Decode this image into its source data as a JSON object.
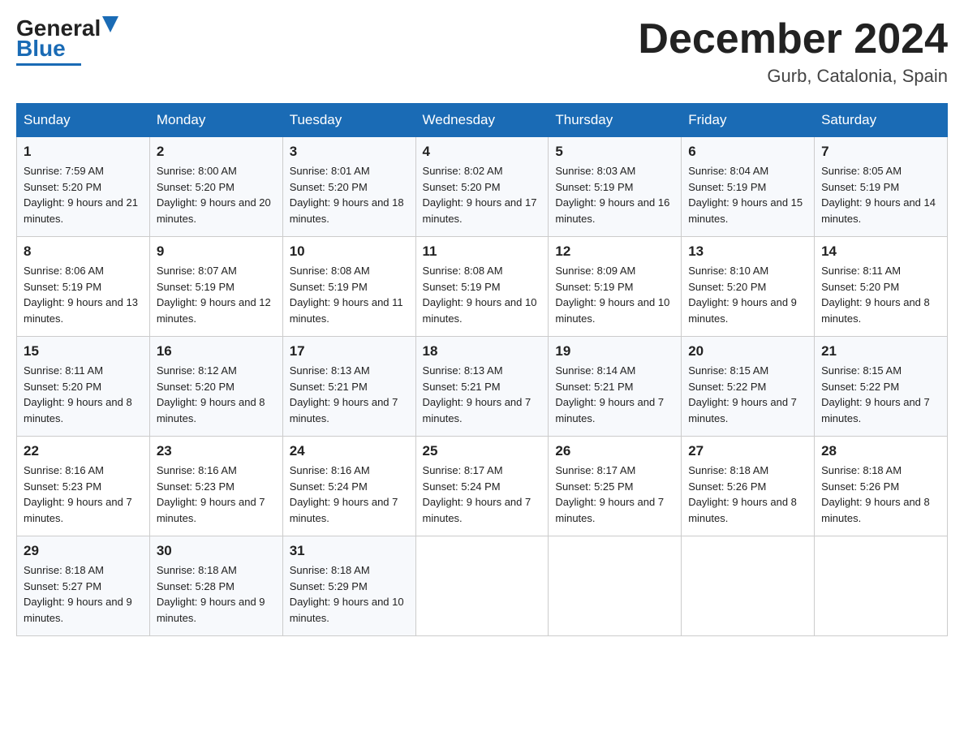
{
  "logo": {
    "text_general": "General",
    "text_blue": "Blue"
  },
  "title": "December 2024",
  "location": "Gurb, Catalonia, Spain",
  "days_of_week": [
    "Sunday",
    "Monday",
    "Tuesday",
    "Wednesday",
    "Thursday",
    "Friday",
    "Saturday"
  ],
  "weeks": [
    [
      {
        "day": "1",
        "sunrise": "7:59 AM",
        "sunset": "5:20 PM",
        "daylight": "9 hours and 21 minutes."
      },
      {
        "day": "2",
        "sunrise": "8:00 AM",
        "sunset": "5:20 PM",
        "daylight": "9 hours and 20 minutes."
      },
      {
        "day": "3",
        "sunrise": "8:01 AM",
        "sunset": "5:20 PM",
        "daylight": "9 hours and 18 minutes."
      },
      {
        "day": "4",
        "sunrise": "8:02 AM",
        "sunset": "5:20 PM",
        "daylight": "9 hours and 17 minutes."
      },
      {
        "day": "5",
        "sunrise": "8:03 AM",
        "sunset": "5:19 PM",
        "daylight": "9 hours and 16 minutes."
      },
      {
        "day": "6",
        "sunrise": "8:04 AM",
        "sunset": "5:19 PM",
        "daylight": "9 hours and 15 minutes."
      },
      {
        "day": "7",
        "sunrise": "8:05 AM",
        "sunset": "5:19 PM",
        "daylight": "9 hours and 14 minutes."
      }
    ],
    [
      {
        "day": "8",
        "sunrise": "8:06 AM",
        "sunset": "5:19 PM",
        "daylight": "9 hours and 13 minutes."
      },
      {
        "day": "9",
        "sunrise": "8:07 AM",
        "sunset": "5:19 PM",
        "daylight": "9 hours and 12 minutes."
      },
      {
        "day": "10",
        "sunrise": "8:08 AM",
        "sunset": "5:19 PM",
        "daylight": "9 hours and 11 minutes."
      },
      {
        "day": "11",
        "sunrise": "8:08 AM",
        "sunset": "5:19 PM",
        "daylight": "9 hours and 10 minutes."
      },
      {
        "day": "12",
        "sunrise": "8:09 AM",
        "sunset": "5:19 PM",
        "daylight": "9 hours and 10 minutes."
      },
      {
        "day": "13",
        "sunrise": "8:10 AM",
        "sunset": "5:20 PM",
        "daylight": "9 hours and 9 minutes."
      },
      {
        "day": "14",
        "sunrise": "8:11 AM",
        "sunset": "5:20 PM",
        "daylight": "9 hours and 8 minutes."
      }
    ],
    [
      {
        "day": "15",
        "sunrise": "8:11 AM",
        "sunset": "5:20 PM",
        "daylight": "9 hours and 8 minutes."
      },
      {
        "day": "16",
        "sunrise": "8:12 AM",
        "sunset": "5:20 PM",
        "daylight": "9 hours and 8 minutes."
      },
      {
        "day": "17",
        "sunrise": "8:13 AM",
        "sunset": "5:21 PM",
        "daylight": "9 hours and 7 minutes."
      },
      {
        "day": "18",
        "sunrise": "8:13 AM",
        "sunset": "5:21 PM",
        "daylight": "9 hours and 7 minutes."
      },
      {
        "day": "19",
        "sunrise": "8:14 AM",
        "sunset": "5:21 PM",
        "daylight": "9 hours and 7 minutes."
      },
      {
        "day": "20",
        "sunrise": "8:15 AM",
        "sunset": "5:22 PM",
        "daylight": "9 hours and 7 minutes."
      },
      {
        "day": "21",
        "sunrise": "8:15 AM",
        "sunset": "5:22 PM",
        "daylight": "9 hours and 7 minutes."
      }
    ],
    [
      {
        "day": "22",
        "sunrise": "8:16 AM",
        "sunset": "5:23 PM",
        "daylight": "9 hours and 7 minutes."
      },
      {
        "day": "23",
        "sunrise": "8:16 AM",
        "sunset": "5:23 PM",
        "daylight": "9 hours and 7 minutes."
      },
      {
        "day": "24",
        "sunrise": "8:16 AM",
        "sunset": "5:24 PM",
        "daylight": "9 hours and 7 minutes."
      },
      {
        "day": "25",
        "sunrise": "8:17 AM",
        "sunset": "5:24 PM",
        "daylight": "9 hours and 7 minutes."
      },
      {
        "day": "26",
        "sunrise": "8:17 AM",
        "sunset": "5:25 PM",
        "daylight": "9 hours and 7 minutes."
      },
      {
        "day": "27",
        "sunrise": "8:18 AM",
        "sunset": "5:26 PM",
        "daylight": "9 hours and 8 minutes."
      },
      {
        "day": "28",
        "sunrise": "8:18 AM",
        "sunset": "5:26 PM",
        "daylight": "9 hours and 8 minutes."
      }
    ],
    [
      {
        "day": "29",
        "sunrise": "8:18 AM",
        "sunset": "5:27 PM",
        "daylight": "9 hours and 9 minutes."
      },
      {
        "day": "30",
        "sunrise": "8:18 AM",
        "sunset": "5:28 PM",
        "daylight": "9 hours and 9 minutes."
      },
      {
        "day": "31",
        "sunrise": "8:18 AM",
        "sunset": "5:29 PM",
        "daylight": "9 hours and 10 minutes."
      },
      null,
      null,
      null,
      null
    ]
  ]
}
